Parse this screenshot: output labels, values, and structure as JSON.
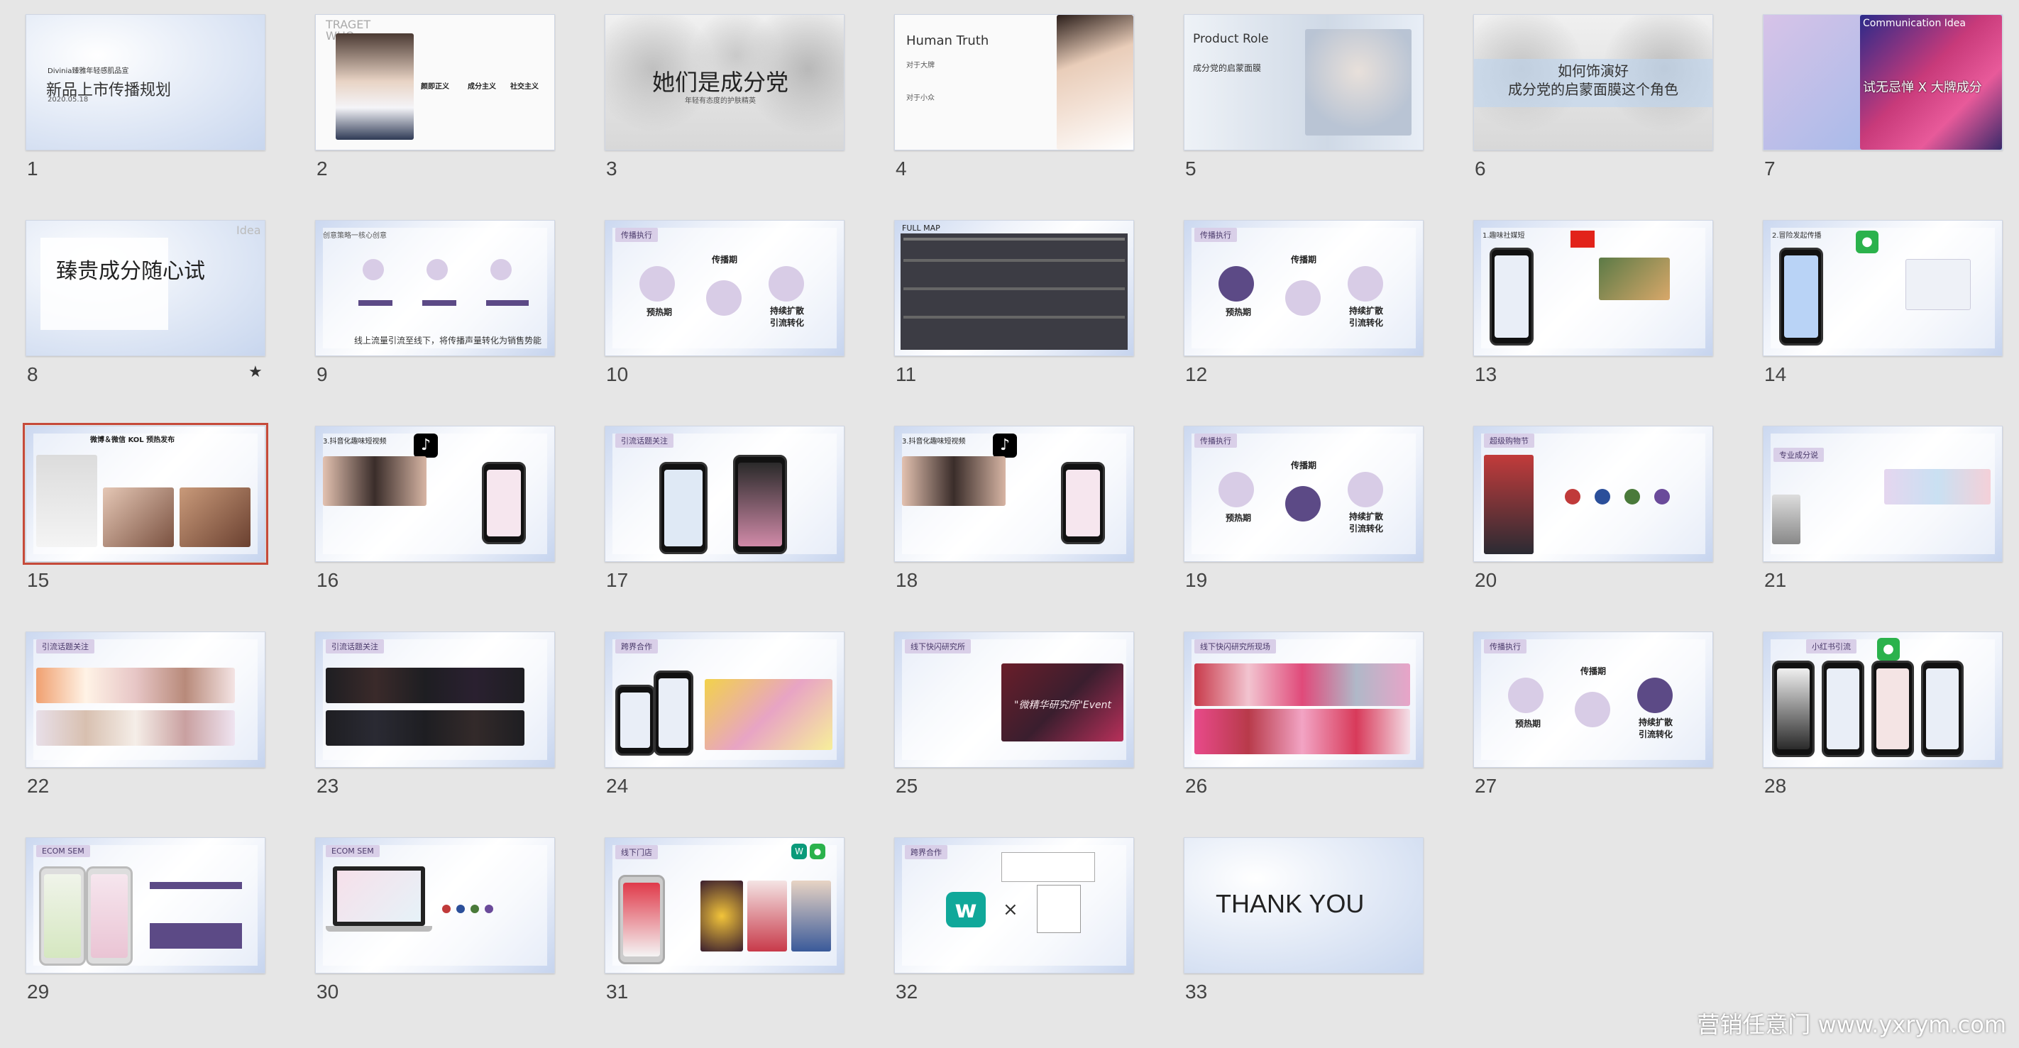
{
  "slides": [
    {
      "num": "1",
      "title": "新品上市传播规划",
      "subtitle": "Divinia臻雅年轻感肌品宣",
      "date": "2020.05.18"
    },
    {
      "num": "2",
      "title": "TRAGET\nWHO",
      "c1": "颜即正义",
      "c2": "成分主义",
      "c3": "社交主义"
    },
    {
      "num": "3",
      "title": "她们是成分党",
      "subtitle": "年轻有态度的护肤精英"
    },
    {
      "num": "4",
      "title": "Human Truth",
      "line1": "对于大牌",
      "line2": "对于小众"
    },
    {
      "num": "5",
      "title": "Product Role",
      "line1": "成分党的启蒙面膜"
    },
    {
      "num": "6",
      "title": "如何饰演好\n成分党的启蒙面膜这个角色"
    },
    {
      "num": "7",
      "title": "Communication Idea",
      "line1": "试无忌惮 X 大牌成分"
    },
    {
      "num": "8",
      "title": "臻贵成分随心试",
      "corner": "Idea",
      "star": "★"
    },
    {
      "num": "9",
      "title": "创意策略一核心创意",
      "footer": "线上流量引流至线下，将传播声量转化为销售势能"
    },
    {
      "num": "10",
      "title": "传播执行",
      "a": "传播期",
      "b": "预热期",
      "c": "持续扩散\n引流转化"
    },
    {
      "num": "11",
      "title": "FULL MAP"
    },
    {
      "num": "12",
      "title": "传播执行",
      "a": "传播期",
      "b": "预热期",
      "c": "持续扩散\n引流转化"
    },
    {
      "num": "13",
      "title": "1.趣味社媒短"
    },
    {
      "num": "14",
      "title": "2.冒险发起传播"
    },
    {
      "num": "15",
      "title": "微博＆微信 KOL 预热发布"
    },
    {
      "num": "16",
      "title": "3.抖音化趣味短视频"
    },
    {
      "num": "17",
      "title": "引流话题关注"
    },
    {
      "num": "18",
      "title": "3.抖音化趣味短视频"
    },
    {
      "num": "19",
      "title": "传播执行",
      "a": "传播期",
      "b": "预热期",
      "c": "持续扩散\n引流转化"
    },
    {
      "num": "20",
      "title": "超级购物节"
    },
    {
      "num": "21",
      "title": "专业成分说"
    },
    {
      "num": "22",
      "title": "引流话题关注"
    },
    {
      "num": "23",
      "title": "引流话题关注"
    },
    {
      "num": "24",
      "title": "跨界合作"
    },
    {
      "num": "25",
      "title": "线下快闪研究所",
      "line1": "\"微精华研究所\"Event"
    },
    {
      "num": "26",
      "title": "线下快闪研究所现场"
    },
    {
      "num": "27",
      "title": "传播执行",
      "a": "传播期",
      "b": "预热期",
      "c": "持续扩散\n引流转化"
    },
    {
      "num": "28",
      "title": "小红书引流"
    },
    {
      "num": "29",
      "title": "ECOM SEM"
    },
    {
      "num": "30",
      "title": "ECOM SEM"
    },
    {
      "num": "31",
      "title": "线下门店"
    },
    {
      "num": "32",
      "title": "跨界合作",
      "x": "×"
    },
    {
      "num": "33",
      "title": "THANK YOU"
    }
  ],
  "watermark": "营销任意门 www.yxrym.com",
  "colors": {
    "accent": "#5c4a86",
    "selection": "#c64a3a"
  }
}
